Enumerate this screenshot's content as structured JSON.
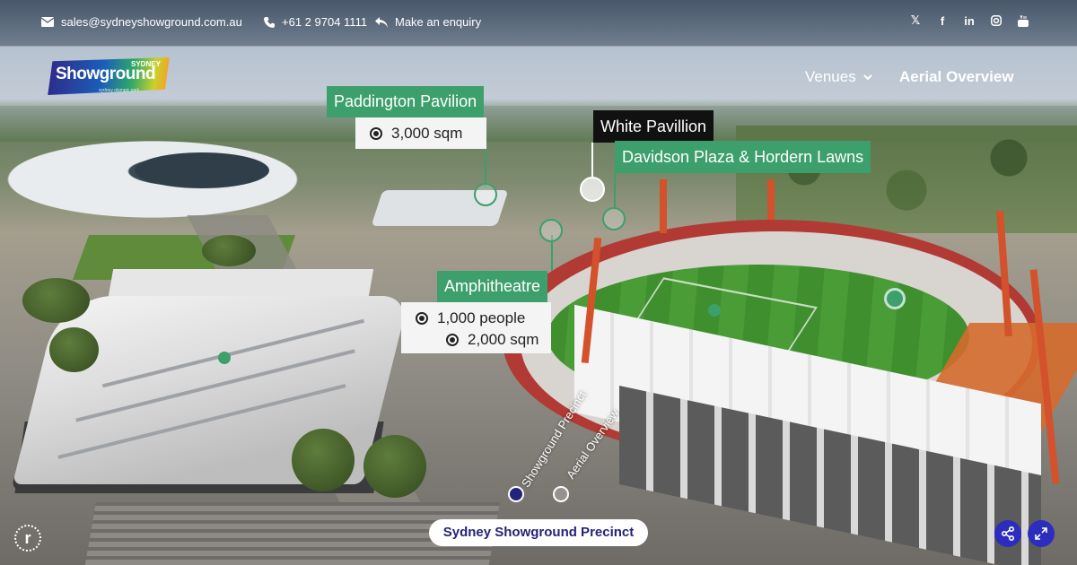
{
  "topbar": {
    "email": "sales@sydneyshowground.com.au",
    "phone": "+61 2 9704 1111",
    "enquiry": "Make an enquiry",
    "social": [
      "x-icon",
      "facebook-icon",
      "linkedin-icon",
      "instagram-icon",
      "youtube-icon"
    ]
  },
  "logo": {
    "word": "Showground",
    "sydney": "SYDNEY",
    "tagline": "sydney olympic park"
  },
  "nav": {
    "venues": "Venues",
    "aerial": "Aerial Overview"
  },
  "hotspots": {
    "paddington": {
      "name": "Paddington Pavilion",
      "area": "3,000 sqm"
    },
    "white": {
      "name": "White Pavillion"
    },
    "davidson": {
      "name": "Davidson Plaza & Hordern Lawns"
    },
    "amphitheatre": {
      "name": "Amphitheatre",
      "capacity": "1,000 people",
      "area": "2,000 sqm"
    }
  },
  "rotated": {
    "showground": "Showground Precinct",
    "aerial": "Aerial Overview"
  },
  "footer": {
    "precinct": "Sydney Showground Precinct",
    "brand_initial": "r"
  },
  "colors": {
    "accent": "#3d9f6b",
    "brand": "#23237a",
    "button": "#2d2dbd"
  }
}
